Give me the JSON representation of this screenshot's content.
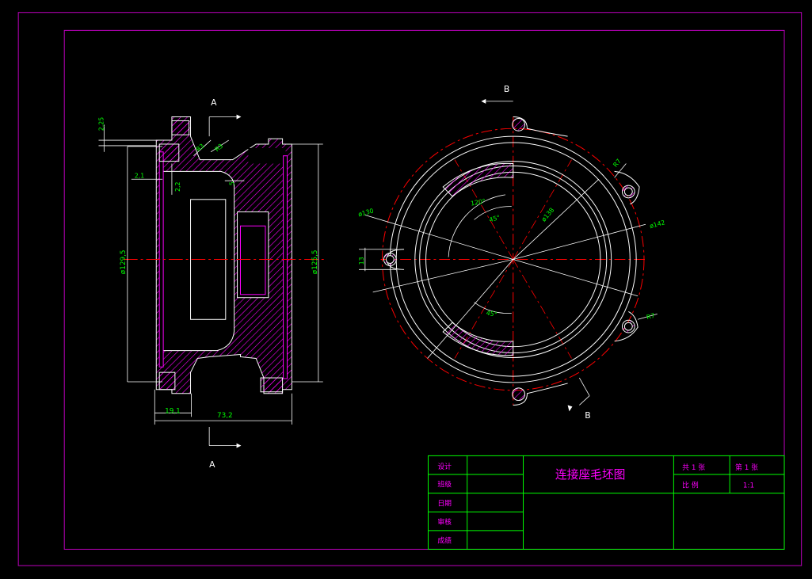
{
  "toolbar": {
    "tabs": [
      {
        "label": ""
      },
      {
        "label": ""
      },
      {
        "label": ""
      },
      {
        "label": ""
      },
      {
        "label": ""
      },
      {
        "label": ""
      }
    ]
  },
  "drawing": {
    "section_marks": {
      "a_top": "A",
      "a_bottom": "A",
      "b_top": "B",
      "b_bottom": "B"
    },
    "dimensions": {
      "d_2_25": "2,25",
      "d_2_1": "2,1",
      "d_2_2": "2,2",
      "d_r3_a": "R3",
      "d_r3_b": "R3",
      "d_5": "5",
      "d_129_5": "ø129,5",
      "d_125_5": "ø125,5",
      "d_19_1": "19,1",
      "d_73_2": "73,2",
      "d_130": "ø130",
      "d_120deg": "120°",
      "d_45deg_a": "45°",
      "d_45deg_b": "45°",
      "d_138": "ø138",
      "d_142": "ø142",
      "d_13": "13",
      "d_r7_a": "R7",
      "d_r7_b": "R7"
    }
  },
  "title_block": {
    "title": "连接座毛坯图",
    "row_labels": [
      "设计",
      "班级",
      "日期",
      "审核",
      "成绩"
    ],
    "total_sheets": "共 1 张",
    "sheet_no": "第 1 张",
    "scale_label": "比 例",
    "scale_value": "1:1"
  },
  "colors": {
    "magenta": "#ff00ff",
    "green": "#00ff00",
    "white": "#ffffff",
    "red": "#ff0000",
    "border": "#c000c0"
  }
}
